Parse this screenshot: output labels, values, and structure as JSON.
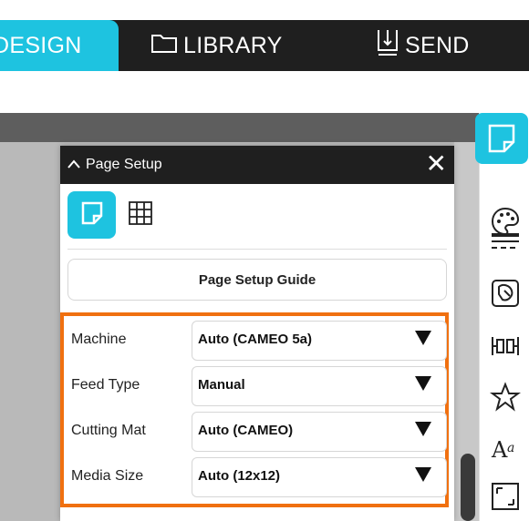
{
  "nav": {
    "tabs": [
      {
        "label": "DESIGN",
        "icon": "design-icon",
        "active": true
      },
      {
        "label": "LIBRARY",
        "icon": "folder-icon",
        "active": false
      },
      {
        "label": "SEND",
        "icon": "send-icon",
        "active": false
      }
    ]
  },
  "colors": {
    "accent": "#1ec3e0",
    "highlight": "#f07010",
    "dark": "#1f1f1f"
  },
  "panel": {
    "title": "Page Setup",
    "collapse_icon": "chevron-up-icon",
    "close_icon": "close-icon",
    "close_glyph": "✕",
    "views": [
      {
        "icon": "page-icon",
        "active": true
      },
      {
        "icon": "grid-icon",
        "active": false
      }
    ],
    "guide_button": "Page Setup Guide",
    "fields": [
      {
        "label": "Machine",
        "value": "Auto (CAMEO 5a)"
      },
      {
        "label": "Feed Type",
        "value": "Manual"
      },
      {
        "label": "Cutting Mat",
        "value": "Auto (CAMEO)"
      },
      {
        "label": "Media Size",
        "value": "Auto (12x12)"
      }
    ]
  },
  "right_toolbar": {
    "icons": [
      "page-setup-icon",
      "fill-palette-icon",
      "line-style-icon",
      "trace-icon",
      "align-icon",
      "replicate-icon",
      "text-style-icon",
      "transform-icon"
    ]
  }
}
